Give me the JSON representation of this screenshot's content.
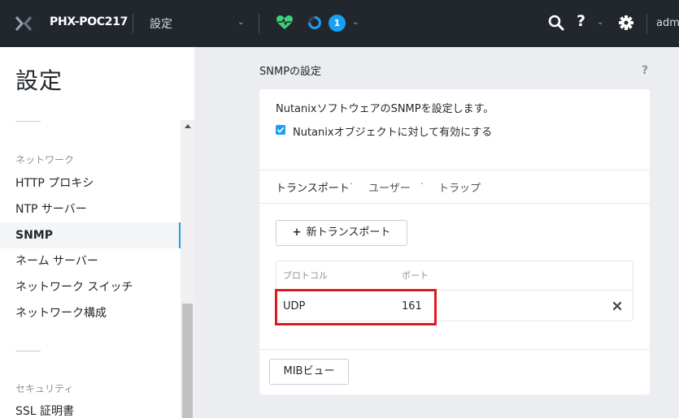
{
  "topbar": {
    "cluster_name": "PHX-POC217",
    "breadcrumb": "設定",
    "alert_count": "1",
    "help_label": "?",
    "user": "adm",
    "icons": [
      "nutanix-logo-icon",
      "chevron-down-icon",
      "heart-pulse-icon",
      "task-ring-icon",
      "search-icon",
      "question-icon",
      "gear-icon"
    ],
    "colors": {
      "bar": "#22272e",
      "health": "#3fd17a",
      "badge": "#1a9ff2"
    }
  },
  "sidebar": {
    "title": "設定",
    "sections": [
      {
        "label": "ネットワーク",
        "items": [
          {
            "label": "HTTP プロキシ",
            "active": false
          },
          {
            "label": "NTP サーバー",
            "active": false
          },
          {
            "label": "SNMP",
            "active": true
          },
          {
            "label": "ネーム サーバー",
            "active": false
          },
          {
            "label": "ネットワーク スイッチ",
            "active": false
          },
          {
            "label": "ネットワーク構成",
            "active": false
          }
        ]
      },
      {
        "label": "セキュリティ",
        "items": [
          {
            "label": "SSL 証明書",
            "active": false
          }
        ]
      }
    ]
  },
  "main": {
    "title": "SNMPの設定",
    "help_label": "?",
    "description": "NutanixソフトウェアのSNMPを設定します。",
    "checkbox": {
      "label": "Nutanixオブジェクトに対して有効にする",
      "checked": true
    },
    "tabs": [
      {
        "label": "トランスポート",
        "active": true
      },
      {
        "label": "ユーザー",
        "active": false
      },
      {
        "label": "トラップ",
        "active": false
      }
    ],
    "tab_separator": "·",
    "new_transport_plus": "+",
    "new_transport_label": "新トランスポート",
    "table": {
      "headers": [
        "プロトコル",
        "ポート"
      ],
      "rows": [
        {
          "protocol": "UDP",
          "port": "161"
        }
      ]
    },
    "mib_button_label": "MIBビュー",
    "highlight_color": "#e0191f"
  }
}
